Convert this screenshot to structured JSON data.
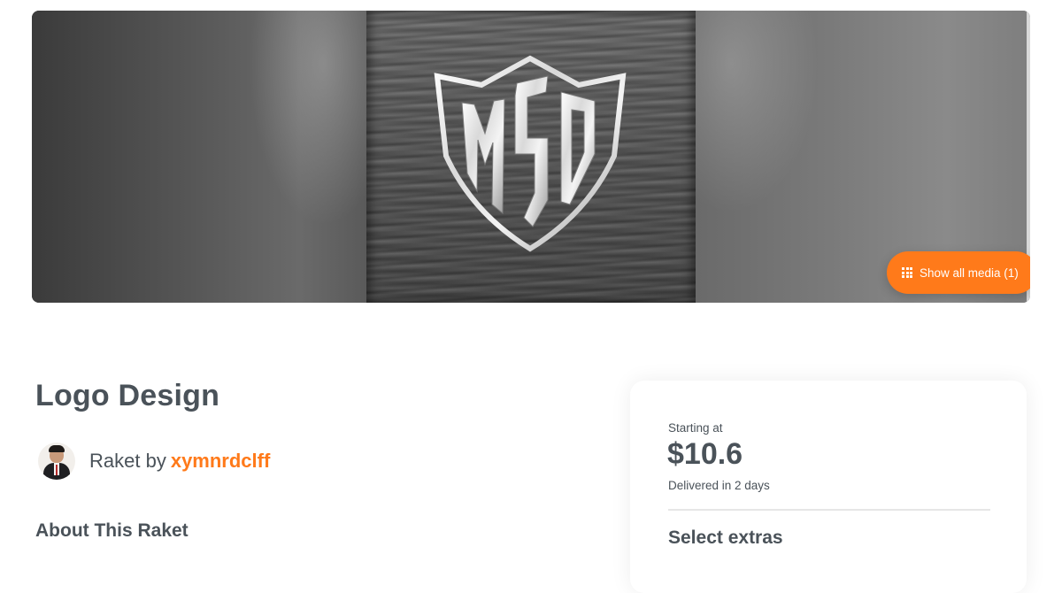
{
  "hero": {
    "image_alt": "MSD",
    "show_media_label": "Show all media (1)",
    "show_media_icon": "grid-icon",
    "accent_color": "#ff7a1a"
  },
  "raket": {
    "title": "Logo Design",
    "author_prefix": "Raket by",
    "author_username": "xymnrdclff",
    "about_heading": "About This Raket"
  },
  "pricing": {
    "starting_label": "Starting at",
    "price": "$10.6",
    "delivery": "Delivered in 2 days",
    "extras_heading": "Select extras"
  }
}
